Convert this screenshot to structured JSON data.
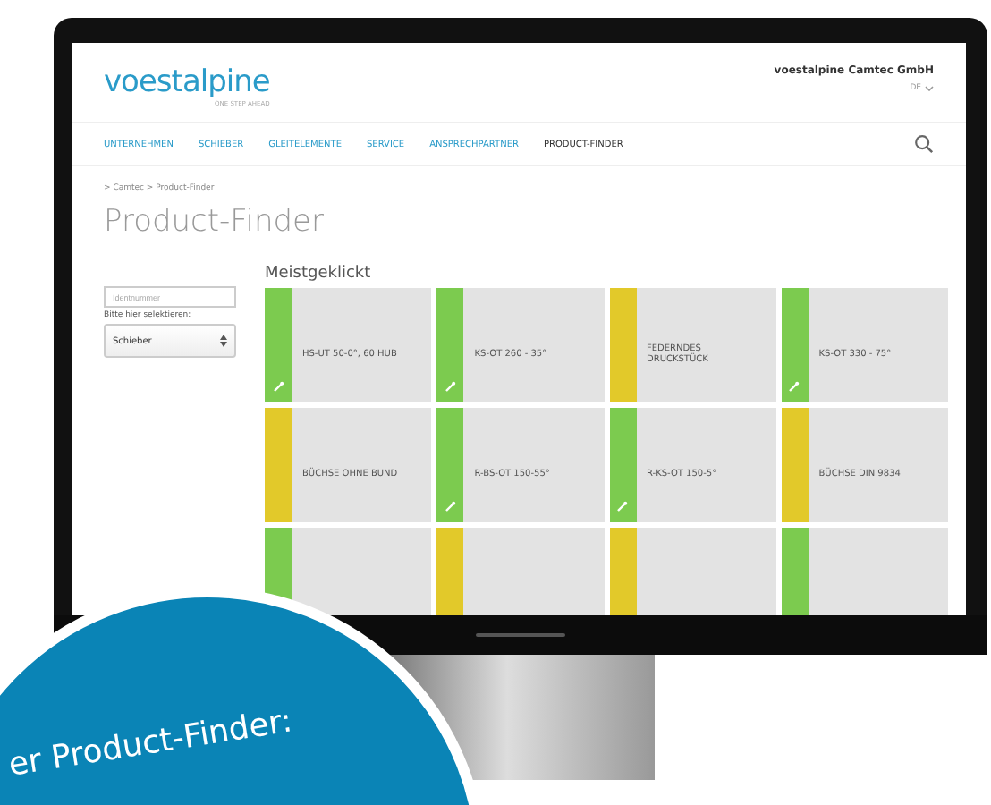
{
  "header": {
    "logo": "voestalpine",
    "tagline": "ONE STEP AHEAD",
    "company": "voestalpine Camtec GmbH",
    "language": "DE"
  },
  "nav": [
    {
      "label": "UNTERNEHMEN",
      "selected": false
    },
    {
      "label": "SCHIEBER",
      "selected": false
    },
    {
      "label": "GLEITELEMENTE",
      "selected": false
    },
    {
      "label": "SERVICE",
      "selected": false
    },
    {
      "label": "ANSPRECHPARTNER",
      "selected": false
    },
    {
      "label": "PRODUCT-FINDER",
      "selected": true
    }
  ],
  "breadcrumb": "> Camtec > Product-Finder",
  "title": "Product-Finder",
  "sidebar": {
    "search": {
      "placeholder": "Identnummer"
    },
    "label": "Bitte hier selektieren:",
    "select": "Schieber"
  },
  "section_title": "Meistgeklickt",
  "tiles": [
    {
      "title": "HS-UT 50-0°, 60 HUB",
      "color": "#7ccb4f",
      "icon": true
    },
    {
      "title": "KS-OT 260 - 35°",
      "color": "#7ccb4f",
      "icon": true
    },
    {
      "title": "FEDERNDES DRUCKSTÜCK",
      "color": "#e2c92a",
      "icon": false
    },
    {
      "title": "KS-OT 330 - 75°",
      "color": "#7ccb4f",
      "icon": true
    },
    {
      "title": "BÜCHSE OHNE BUND",
      "color": "#e2c92a",
      "icon": false
    },
    {
      "title": "R-BS-OT 150-55°",
      "color": "#7ccb4f",
      "icon": true
    },
    {
      "title": "R-KS-OT 150-5°",
      "color": "#7ccb4f",
      "icon": true
    },
    {
      "title": "BÜCHSE DIN 9834",
      "color": "#e2c92a",
      "icon": false
    },
    {
      "color": "#7ccb4f"
    },
    {
      "color": "#e2c92a"
    },
    {
      "color": "#e2c92a"
    },
    {
      "color": "#7ccb4f"
    }
  ],
  "badge": {
    "text": "er Product-Finder:"
  }
}
